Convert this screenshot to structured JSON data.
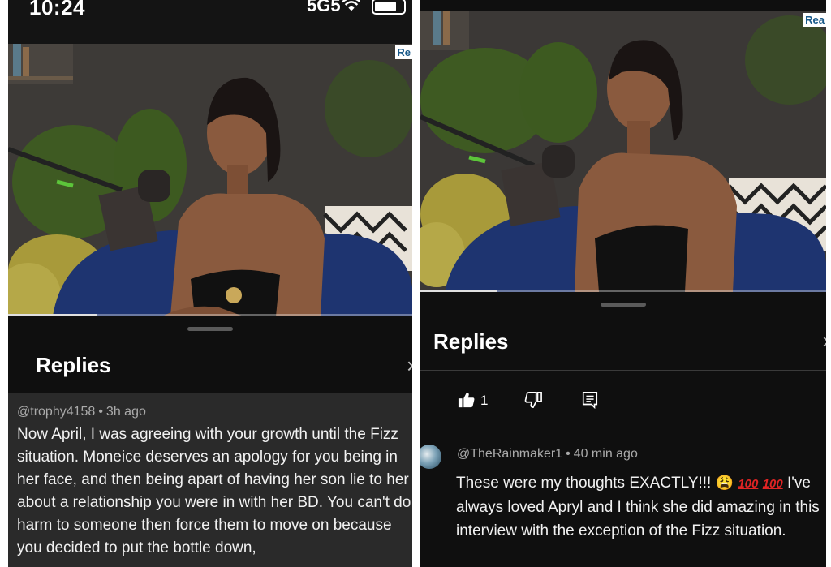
{
  "status_bar": {
    "time": "10:24",
    "signal": "5G5"
  },
  "left": {
    "channel_logo": "Re",
    "sheet_title": "Replies",
    "close_glyph": "×",
    "comment": {
      "author": "@trophy4158",
      "time": "3h ago",
      "text": "Now April, I was agreeing with your growth until the Fizz situation. Moneice deserves an apology for you being in her face, and then being apart of having her son lie to her about a relationship you were in with her BD. You can't do harm to someone then force them to move on because you decided to put the bottle down,"
    }
  },
  "right": {
    "channel_logo": "Rea",
    "sheet_title": "Replies",
    "close_glyph": "×",
    "actions": {
      "like_count": "1"
    },
    "comment": {
      "author": "@TheRainmaker1",
      "time": "40 min ago",
      "text_main": "These were my thoughts EXACTLY!!!",
      "emoji_1": "😩",
      "emoji_2": "100",
      "emoji_3": "100",
      "text_rest": "I've always loved Apryl and I think she did amazing in this interview with the exception of the Fizz situation."
    }
  },
  "icons": {
    "like": "thumbs-up-icon",
    "dislike": "thumbs-down-icon",
    "reply": "reply-comment-icon",
    "wifi": "wifi-icon",
    "battery": "battery-icon"
  },
  "colors": {
    "sheet_bg": "#0f0f0f",
    "highlight_bg": "#2a2a2a",
    "meta_text": "#aaaaaa",
    "body_text": "#f1f1f1"
  }
}
